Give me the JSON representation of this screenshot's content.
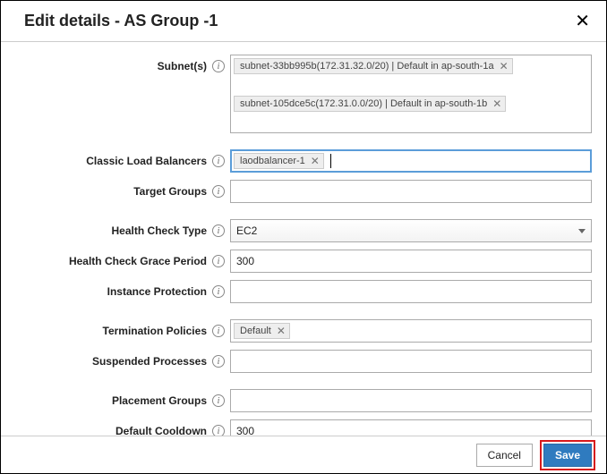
{
  "header": {
    "title": "Edit details - AS Group -1"
  },
  "labels": {
    "subnets": "Subnet(s)",
    "classicLoadBalancers": "Classic Load Balancers",
    "targetGroups": "Target Groups",
    "healthCheckType": "Health Check Type",
    "healthCheckGracePeriod": "Health Check Grace Period",
    "instanceProtection": "Instance Protection",
    "terminationPolicies": "Termination Policies",
    "suspendedProcesses": "Suspended Processes",
    "placementGroups": "Placement Groups",
    "defaultCooldown": "Default Cooldown"
  },
  "values": {
    "subnets": [
      "subnet-33bb995b(172.31.32.0/20) | Default in ap-south-1a",
      "subnet-105dce5c(172.31.0.0/20) | Default in ap-south-1b"
    ],
    "classicLoadBalancers": [
      "laodbalancer-1"
    ],
    "targetGroups": [],
    "healthCheckType": "EC2",
    "healthCheckGracePeriod": "300",
    "instanceProtection": [],
    "terminationPolicies": [
      "Default"
    ],
    "suspendedProcesses": [],
    "placementGroups": [],
    "defaultCooldown": "300"
  },
  "footer": {
    "cancel": "Cancel",
    "save": "Save"
  }
}
